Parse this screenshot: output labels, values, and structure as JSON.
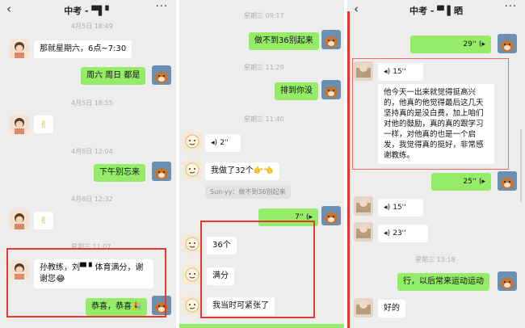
{
  "colors": {
    "bubble_out": "#95ec69",
    "bubble_in": "#ffffff",
    "highlight": "#e8372f",
    "background": "#ededed"
  },
  "panel1": {
    "nav": {
      "back": "‹",
      "title": "中考 - ▀▌▘",
      "more": "···"
    },
    "ts1": "4月5日 18:49",
    "msg1": "那就星期六，6点~7:30",
    "msg2": "周六  周日  都是",
    "ts2": "4月5日 18:55",
    "msg3": "✌",
    "ts3": "4月8日 12:04",
    "msg4": "下午别忘来",
    "ts4": "4月8日 12:32",
    "msg5": "✌",
    "ts5": "星期三 11:07",
    "msg6": "孙教练，刘▀ ▘体育满分，谢谢您😂",
    "msg7": "恭喜，恭喜🎉"
  },
  "panel2": {
    "ts1": "星期三 09:17",
    "msg1": "做不到36别起来",
    "ts2": "星期三 11:29",
    "msg2": "排到你没",
    "ts3": "星期三 11:40",
    "voice1": "2''",
    "msg3": "我做了32个👉👈",
    "quote": "Sun-yy：做不到36别起来",
    "voice2": "7''",
    "msg4": "36个",
    "msg5": "满分",
    "msg6": "我当时可紧张了"
  },
  "panel3": {
    "nav": {
      "back": "‹",
      "title": "中考 - ▀ ▌晒",
      "more": "···"
    },
    "voice1": "29''",
    "voice2": "15''",
    "transcript": "他今天一出来就觉得挺高兴的，他真的他觉得最后这几天坚持真的是没白费，加上咱们对他的鼓励，真的真的跟学习一样，对他真的也是一个启发，我觉得真的挺好，非常感谢教练。",
    "voice3": "25''",
    "voice4": "15''",
    "voice5": "23''",
    "ts1": "星期三 13:18",
    "msg1": "行，以后常来运动运动",
    "msg2": "好的"
  }
}
